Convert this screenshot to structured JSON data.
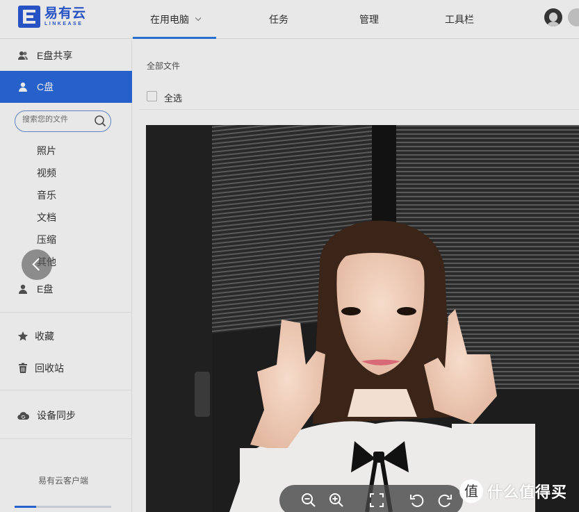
{
  "app": {
    "logo_cn": "易有云",
    "logo_en": "LINKEASE",
    "brand_color": "#2a5bd7"
  },
  "nav": {
    "tabs": [
      {
        "label": "在用电脑",
        "active": true,
        "has_dropdown": true
      },
      {
        "label": "任务"
      },
      {
        "label": "管理"
      },
      {
        "label": "工具栏"
      }
    ]
  },
  "sidebar": {
    "share_label": "E盘共享",
    "c_drive_label": "C盘",
    "search_placeholder": "搜索您的文件",
    "categories": [
      "照片",
      "视频",
      "音乐",
      "文档",
      "压缩",
      "其他"
    ],
    "e_drive_label": "E盘",
    "favorites_label": "收藏",
    "recycle_label": "回收站",
    "sync_label": "设备同步",
    "client_label": "易有云客户端",
    "progress": 0.22,
    "accent_color": "#2a6ae0"
  },
  "main": {
    "breadcrumb": "全部文件",
    "select_all": "全选"
  },
  "viewer": {
    "image_subject": "photo of young woman making peace signs",
    "toolbar_icons": [
      "zoom-out-icon",
      "zoom-in-icon",
      "fullscreen-icon",
      "rotate-left-icon",
      "rotate-right-icon"
    ],
    "watermark_text": "什么值得买",
    "prev_icon": "chevron-left-icon"
  }
}
